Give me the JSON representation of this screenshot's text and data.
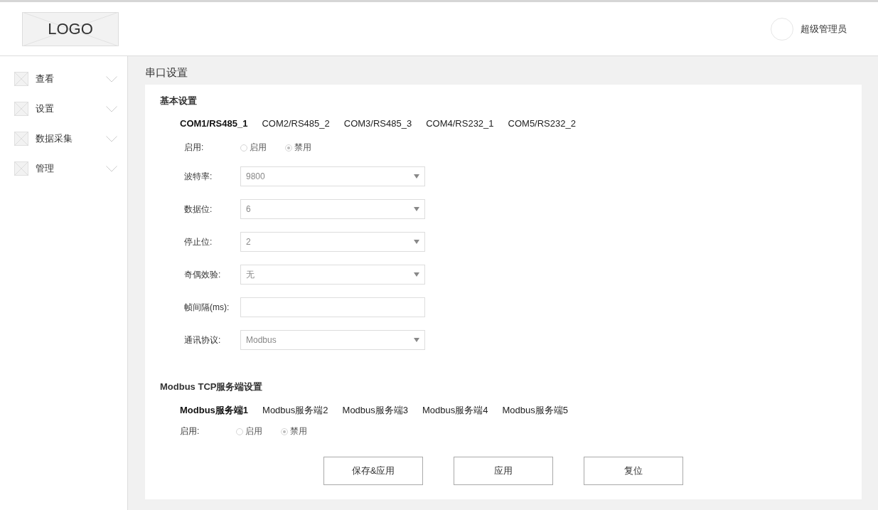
{
  "header": {
    "logo": "LOGO",
    "user": "超级管理员"
  },
  "sidebar": {
    "items": [
      {
        "label": "查看"
      },
      {
        "label": "设置"
      },
      {
        "label": "数据采集"
      },
      {
        "label": "管理"
      }
    ]
  },
  "page_title": "串口设置",
  "basic": {
    "title": "基本设置",
    "tabs": [
      {
        "label": "COM1/RS485_1",
        "selected": true
      },
      {
        "label": "COM2/RS485_2",
        "selected": false
      },
      {
        "label": "COM3/RS485_3",
        "selected": false
      },
      {
        "label": "COM4/RS232_1",
        "selected": false
      },
      {
        "label": "COM5/RS232_2",
        "selected": false
      }
    ],
    "enable": {
      "label": "启用:",
      "options": [
        {
          "label": "启用",
          "selected": false
        },
        {
          "label": "禁用",
          "selected": true
        }
      ]
    },
    "fields": [
      {
        "label": "波特率:",
        "kind": "select",
        "value": "9800"
      },
      {
        "label": "数据位:",
        "kind": "select",
        "value": "6"
      },
      {
        "label": "停止位:",
        "kind": "select",
        "value": "2"
      },
      {
        "label": "奇偶效验:",
        "kind": "select",
        "value": "无"
      },
      {
        "label": "帧间隔(ms):",
        "kind": "input"
      },
      {
        "label": "通讯协议:",
        "kind": "select",
        "value": "Modbus"
      }
    ]
  },
  "modbus": {
    "title": "Modbus TCP服务端设置",
    "tabs": [
      {
        "label": "Modbus服务端1",
        "selected": true
      },
      {
        "label": "Modbus服务端2",
        "selected": false
      },
      {
        "label": "Modbus服务端3",
        "selected": false
      },
      {
        "label": "Modbus服务端4",
        "selected": false
      },
      {
        "label": "Modbus服务端5",
        "selected": false
      }
    ],
    "enable": {
      "label": "启用:",
      "options": [
        {
          "label": "启用",
          "selected": false
        },
        {
          "label": "禁用",
          "selected": true
        }
      ]
    }
  },
  "buttons": [
    "保存&应用",
    "应用",
    "复位"
  ]
}
